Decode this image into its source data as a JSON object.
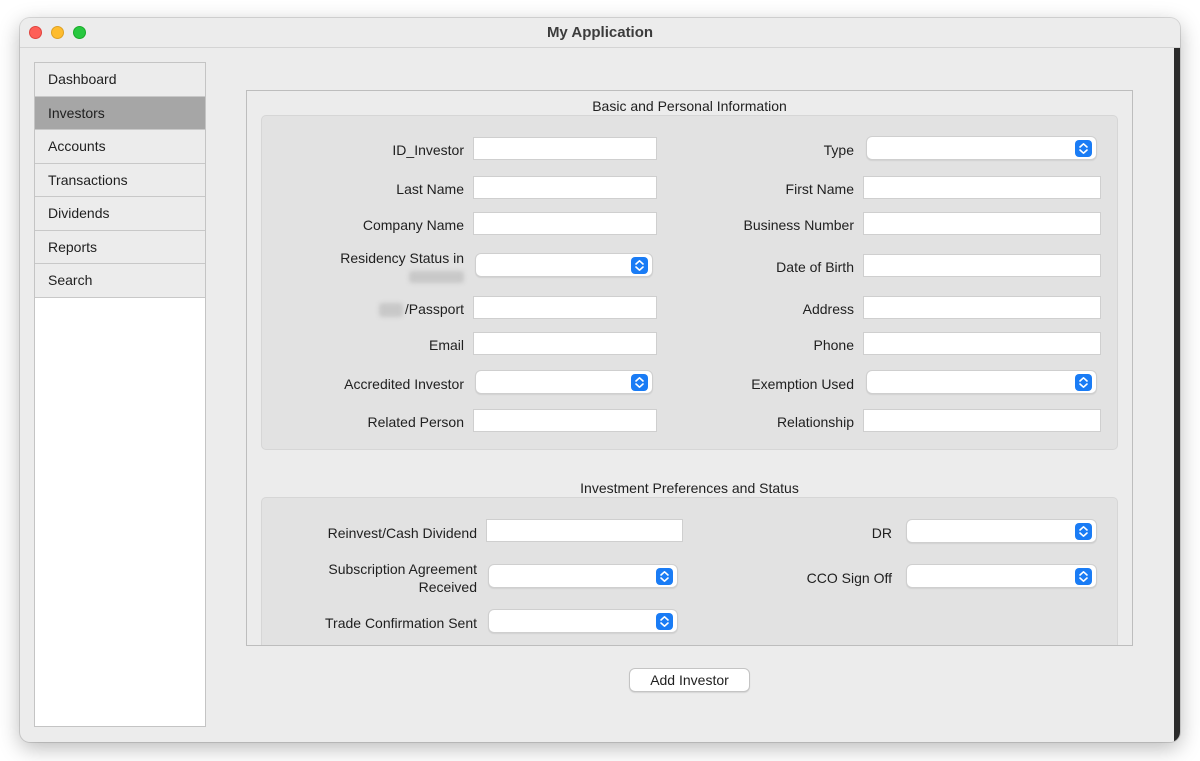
{
  "window": {
    "title": "My Application"
  },
  "sidebar": {
    "items": [
      {
        "label": "Dashboard",
        "active": false
      },
      {
        "label": "Investors",
        "active": true
      },
      {
        "label": "Accounts",
        "active": false
      },
      {
        "label": "Transactions",
        "active": false
      },
      {
        "label": "Dividends",
        "active": false
      },
      {
        "label": "Reports",
        "active": false
      },
      {
        "label": "Search",
        "active": false
      }
    ]
  },
  "basic": {
    "title": "Basic and Personal Information",
    "id_investor": {
      "label": "ID_Investor",
      "value": ""
    },
    "type": {
      "label": "Type",
      "value": ""
    },
    "last_name": {
      "label": "Last Name",
      "value": ""
    },
    "first_name": {
      "label": "First Name",
      "value": ""
    },
    "company_name": {
      "label": "Company Name",
      "value": ""
    },
    "business_number": {
      "label": "Business Number",
      "value": ""
    },
    "residency_status": {
      "label": "Residency Status in",
      "value": ""
    },
    "date_of_birth": {
      "label": "Date of Birth",
      "value": ""
    },
    "passport": {
      "label": "/Passport",
      "value": ""
    },
    "address": {
      "label": "Address",
      "value": ""
    },
    "email": {
      "label": "Email",
      "value": ""
    },
    "phone": {
      "label": "Phone",
      "value": ""
    },
    "accredited_investor": {
      "label": "Accredited Investor",
      "value": ""
    },
    "exemption_used": {
      "label": "Exemption Used",
      "value": ""
    },
    "related_person": {
      "label": "Related Person",
      "value": ""
    },
    "relationship": {
      "label": "Relationship",
      "value": ""
    }
  },
  "investment": {
    "title": "Investment Preferences and Status",
    "reinvest_cash": {
      "label": "Reinvest/Cash Dividend",
      "value": ""
    },
    "dr": {
      "label": "DR",
      "value": ""
    },
    "subscription_line1": "Subscription Agreement",
    "subscription_line2": "Received",
    "subscription_value": "",
    "cco_sign_off": {
      "label": "CCO Sign Off",
      "value": ""
    },
    "trade_confirmation": {
      "label": "Trade Confirmation Sent",
      "value": ""
    }
  },
  "actions": {
    "add_investor": "Add Investor"
  },
  "colors": {
    "accent": "#1a7cf5",
    "sidebar_active": "#a6a6a6",
    "background": "#ececec"
  }
}
